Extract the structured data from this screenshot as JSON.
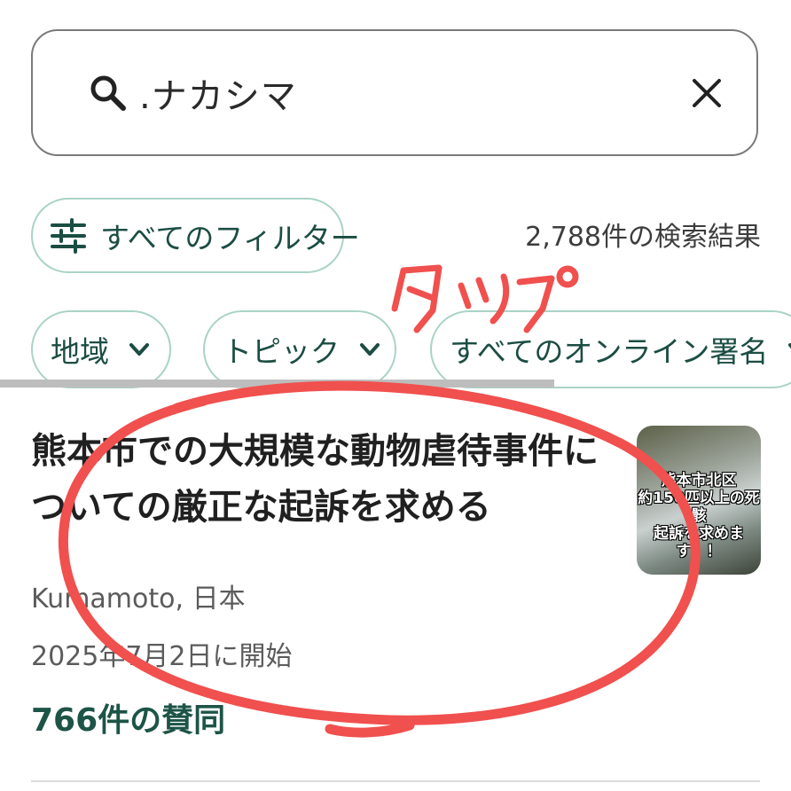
{
  "search": {
    "query": ".ナカシマ",
    "icon": "search-icon",
    "clear_icon": "close-icon"
  },
  "filters": {
    "all_filters_label": "すべてのフィルター",
    "icon": "sliders-icon",
    "results_count": "2,788件の検索結果",
    "chips": [
      {
        "label": "地域"
      },
      {
        "label": "トピック"
      },
      {
        "label": "すべてのオンライン署名"
      }
    ]
  },
  "result": {
    "title": "熊本市での大規模な動物虐待事件についての厳正な起訴を求める",
    "location": "Kumamoto, 日本",
    "started": "2025年7月2日に開始",
    "supporters": "766件の賛同",
    "thumbnail_caption": [
      "熊本市北区",
      "約150匹以上の死骸",
      "起訴を求めます！！"
    ]
  },
  "annotation": {
    "handwritten_text": "タップ",
    "color": "#f0504e"
  },
  "colors": {
    "accent_green": "#1d5447",
    "chip_border": "#a9d3c6"
  }
}
